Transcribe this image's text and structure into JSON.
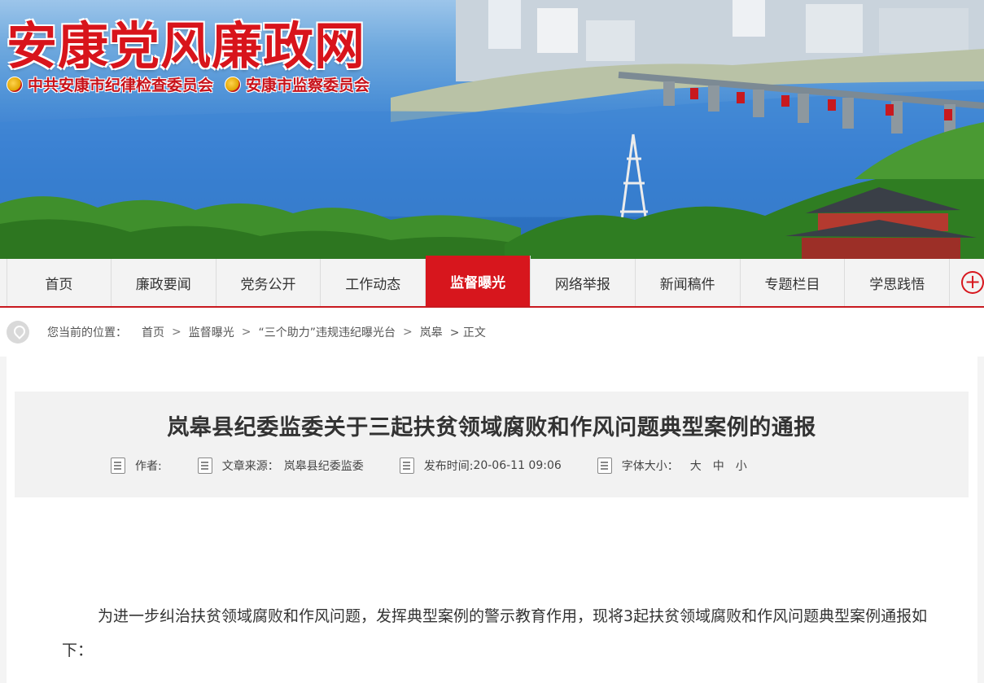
{
  "site": {
    "title": "安康党风廉政网",
    "org1": "中共安康市纪律检查委员会",
    "org2": "安康市监察委员会"
  },
  "nav": {
    "items": [
      "首页",
      "廉政要闻",
      "党务公开",
      "工作动态",
      "监督曝光",
      "网络举报",
      "新闻稿件",
      "专题栏目",
      "学思践悟"
    ],
    "active_index": 4,
    "more": "+"
  },
  "breadcrumb": {
    "prefix": "您当前的位置：",
    "links": [
      "首页",
      "监督曝光",
      "“三个助力”违规违纪曝光台",
      "岚皋"
    ],
    "current": "> 正文"
  },
  "article": {
    "title": "岚皋县纪委监委关于三起扶贫领域腐败和作风问题典型案例的通报",
    "author_label": "作者:",
    "source_label": "文章来源：",
    "source": "岚皋县纪委监委",
    "time_label": "发布时间:",
    "time": "20-06-11 09:06",
    "fontsize_label": "字体大小：",
    "fontsize_large": "大",
    "fontsize_medium": "中",
    "fontsize_small": "小",
    "paragraph": "为进一步纠治扶贫领域腐败和作风问题，发挥典型案例的警示教育作用，现将3起扶贫领域腐败和作风问题典型案例通报如下："
  },
  "colors": {
    "brand_red": "#d7161d",
    "nav_bg": "#f3f3f3",
    "meta_bg": "#f2f2f2"
  }
}
